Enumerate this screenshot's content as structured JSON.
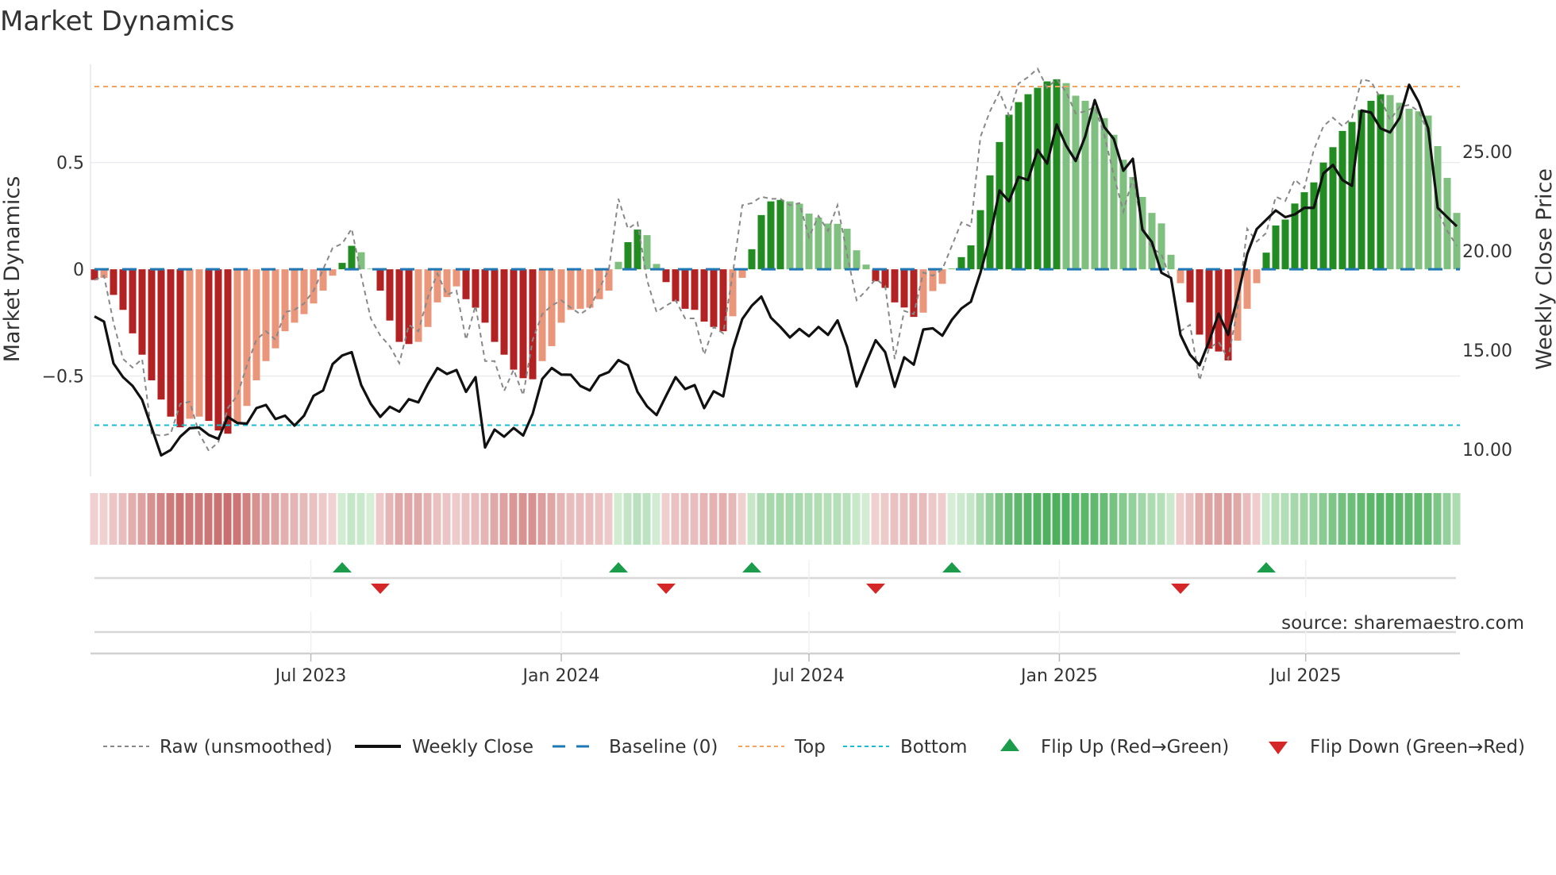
{
  "title": "Market Dynamics",
  "source": "source: sharemaestro.com",
  "colors": {
    "neg_strong": "#b22222",
    "neg_weak": "#e9967a",
    "pos_strong": "#228b22",
    "pos_weak": "#7fbf7f",
    "close": "#111111",
    "raw": "#888888",
    "baseline": "#1f77b4",
    "top": "#f4a460",
    "bottom": "#17becf",
    "flip_up": "#1a9c4a",
    "flip_down": "#d62728"
  },
  "legend": [
    {
      "key": "raw",
      "label": "Raw (unsmoothed)"
    },
    {
      "key": "close",
      "label": "Weekly Close"
    },
    {
      "key": "baseline",
      "label": "Baseline (0)"
    },
    {
      "key": "top",
      "label": "Top"
    },
    {
      "key": "bottom",
      "label": "Bottom"
    },
    {
      "key": "flip_up",
      "label": "Flip Up (Red→Green)"
    },
    {
      "key": "flip_down",
      "label": "Flip Down (Green→Red)"
    }
  ],
  "chart_data": {
    "type": "bar",
    "title": "Market Dynamics",
    "ylabel": "Market Dynamics",
    "y2label": "Weekly Close Price",
    "ylim": [
      -0.97,
      0.96
    ],
    "y2lim": [
      8.64,
      29.4
    ],
    "yticks": [
      {
        "v": 0.5,
        "label": "0.5"
      },
      {
        "v": 0,
        "label": "0"
      },
      {
        "v": -0.5,
        "label": "−0.5"
      }
    ],
    "y2ticks": [
      {
        "v": 25,
        "label": "25.00"
      },
      {
        "v": 20,
        "label": "20.00"
      },
      {
        "v": 15,
        "label": "15.00"
      },
      {
        "v": 10,
        "label": "10.00"
      }
    ],
    "start_date": "2023-01-23",
    "interval_days": 7,
    "xticks": [
      {
        "date": "2023-07-01",
        "label": "Jul 2023"
      },
      {
        "date": "2024-01-01",
        "label": "Jan 2024"
      },
      {
        "date": "2024-07-01",
        "label": "Jul 2024"
      },
      {
        "date": "2025-01-01",
        "label": "Jan 2025"
      },
      {
        "date": "2025-07-01",
        "label": "Jul 2025"
      }
    ],
    "top_level": 0.856,
    "bottom_level": -0.73,
    "baseline": 0,
    "market_dynamics": [
      -0.05,
      -0.04,
      -0.12,
      -0.19,
      -0.3,
      -0.4,
      -0.52,
      -0.61,
      -0.69,
      -0.74,
      -0.7,
      -0.69,
      -0.71,
      -0.755,
      -0.77,
      -0.72,
      -0.64,
      -0.52,
      -0.43,
      -0.37,
      -0.29,
      -0.25,
      -0.21,
      -0.16,
      -0.1,
      -0.03,
      0.03,
      0.11,
      0.08,
      0.003,
      -0.1,
      -0.24,
      -0.34,
      -0.35,
      -0.34,
      -0.27,
      -0.155,
      -0.13,
      -0.08,
      -0.14,
      -0.18,
      -0.25,
      -0.34,
      -0.4,
      -0.47,
      -0.51,
      -0.515,
      -0.43,
      -0.36,
      -0.25,
      -0.19,
      -0.185,
      -0.18,
      -0.14,
      -0.1,
      0.035,
      0.127,
      0.186,
      0.16,
      0.025,
      -0.06,
      -0.15,
      -0.185,
      -0.19,
      -0.245,
      -0.27,
      -0.29,
      -0.22,
      -0.04,
      0.094,
      0.254,
      0.318,
      0.325,
      0.318,
      0.307,
      0.261,
      0.242,
      0.214,
      0.213,
      0.19,
      0.089,
      0.022,
      -0.056,
      -0.087,
      -0.155,
      -0.179,
      -0.223,
      -0.203,
      -0.102,
      -0.068,
      0.004,
      0.057,
      0.112,
      0.277,
      0.44,
      0.596,
      0.724,
      0.783,
      0.82,
      0.85,
      0.88,
      0.89,
      0.872,
      0.813,
      0.789,
      0.76,
      0.708,
      0.63,
      0.513,
      0.432,
      0.339,
      0.264,
      0.215,
      0.068,
      -0.065,
      -0.155,
      -0.306,
      -0.372,
      -0.385,
      -0.427,
      -0.334,
      -0.185,
      -0.065,
      0.078,
      0.205,
      0.233,
      0.308,
      0.361,
      0.407,
      0.5,
      0.572,
      0.648,
      0.69,
      0.746,
      0.789,
      0.82,
      0.816,
      0.78,
      0.752,
      0.74,
      0.72,
      0.577,
      0.428,
      0.264
    ],
    "raw": [
      -0.05,
      -0.03,
      -0.25,
      -0.42,
      -0.46,
      -0.42,
      -0.77,
      -0.78,
      -0.77,
      -0.63,
      -0.62,
      -0.77,
      -0.85,
      -0.81,
      -0.65,
      -0.59,
      -0.45,
      -0.33,
      -0.29,
      -0.33,
      -0.2,
      -0.19,
      -0.16,
      -0.1,
      0.0,
      0.1,
      0.12,
      0.19,
      -0.03,
      -0.23,
      -0.31,
      -0.36,
      -0.44,
      -0.26,
      -0.29,
      -0.13,
      -0.02,
      -0.12,
      -0.1,
      -0.33,
      -0.17,
      -0.43,
      -0.43,
      -0.57,
      -0.47,
      -0.59,
      -0.33,
      -0.21,
      -0.17,
      -0.145,
      -0.18,
      -0.21,
      -0.18,
      -0.09,
      0.0,
      0.33,
      0.19,
      0.22,
      -0.05,
      -0.2,
      -0.17,
      -0.145,
      -0.23,
      -0.23,
      -0.4,
      -0.27,
      -0.3,
      -0.02,
      0.3,
      0.31,
      0.34,
      0.33,
      0.33,
      0.3,
      0.31,
      0.15,
      0.25,
      0.18,
      0.3,
      0.07,
      -0.145,
      -0.1,
      -0.046,
      -0.077,
      -0.42,
      -0.195,
      -0.21,
      -0.015,
      -0.03,
      0.0,
      0.11,
      0.22,
      0.2,
      0.62,
      0.74,
      0.83,
      0.72,
      0.87,
      0.9,
      0.94,
      0.85,
      0.89,
      0.83,
      0.73,
      0.74,
      0.76,
      0.63,
      0.44,
      0.27,
      0.43,
      0.2,
      0.1,
      0.07,
      -0.05,
      -0.29,
      -0.26,
      -0.52,
      -0.37,
      -0.34,
      -0.42,
      -0.18,
      0.19,
      0.13,
      0.17,
      0.34,
      0.32,
      0.42,
      0.38,
      0.56,
      0.67,
      0.71,
      0.67,
      0.71,
      0.89,
      0.88,
      0.8,
      0.7,
      0.76,
      0.77,
      0.74,
      0.64,
      0.27,
      0.18,
      0.11
    ],
    "weekly_close": [
      16.7,
      16.44,
      14.33,
      13.64,
      13.2,
      12.5,
      11.1,
      9.7,
      9.97,
      10.64,
      11.07,
      11.1,
      10.73,
      10.53,
      11.64,
      11.33,
      11.3,
      12.08,
      12.24,
      11.53,
      11.7,
      11.2,
      11.7,
      12.7,
      12.97,
      14.3,
      14.73,
      14.9,
      13.24,
      12.3,
      11.64,
      12.15,
      11.9,
      12.53,
      12.37,
      13.3,
      14.1,
      13.8,
      14.0,
      12.9,
      13.64,
      10.1,
      11.0,
      10.64,
      11.08,
      10.7,
      11.8,
      13.55,
      14.1,
      13.77,
      13.76,
      13.2,
      12.97,
      13.7,
      13.9,
      14.5,
      14.24,
      12.9,
      12.17,
      11.73,
      12.7,
      13.64,
      13.04,
      13.24,
      12.08,
      12.93,
      12.67,
      15.04,
      16.57,
      17.24,
      17.7,
      16.64,
      16.17,
      15.64,
      16.07,
      15.7,
      16.17,
      15.77,
      16.5,
      15.17,
      13.17,
      14.37,
      15.5,
      14.9,
      13.15,
      14.64,
      14.27,
      16.04,
      16.1,
      15.73,
      16.53,
      17.1,
      17.44,
      18.9,
      20.7,
      23.04,
      22.5,
      23.73,
      23.57,
      25.1,
      24.4,
      26.37,
      25.3,
      24.53,
      25.77,
      27.6,
      26.24,
      25.64,
      24.04,
      24.64,
      21.07,
      20.44,
      18.9,
      18.64,
      15.77,
      14.77,
      14.24,
      15.44,
      16.84,
      15.77,
      17.7,
      19.84,
      21.1,
      21.57,
      22.04,
      21.7,
      21.84,
      22.17,
      22.17,
      23.9,
      24.33,
      23.57,
      23.28,
      27.07,
      26.97,
      26.17,
      25.97,
      26.7,
      28.37,
      27.5,
      26.17,
      22.17,
      21.7,
      21.24
    ],
    "legend_position": "bottom"
  }
}
